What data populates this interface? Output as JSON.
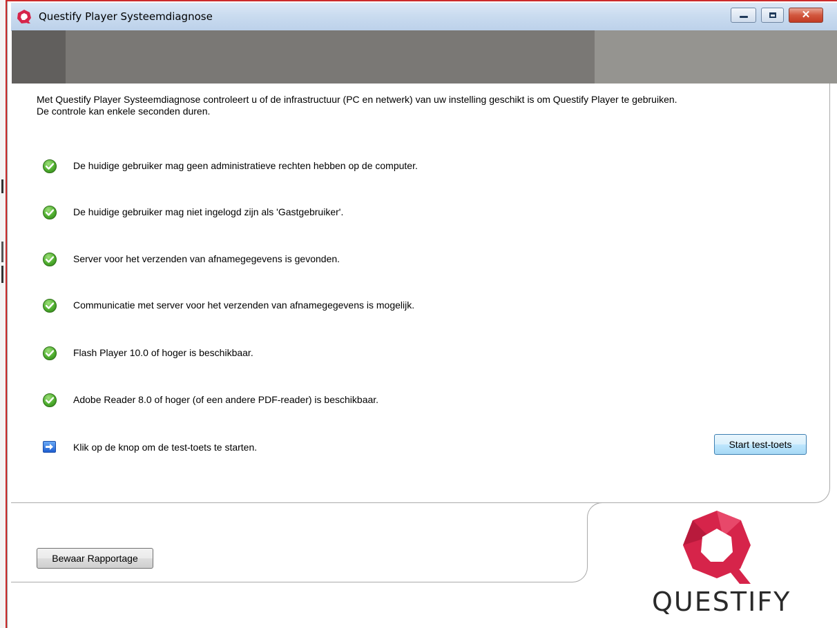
{
  "window": {
    "title": "Questify Player Systeemdiagnose",
    "controls": {
      "minimize": "minimize-icon",
      "maximize": "maximize-icon",
      "close": "close-icon"
    }
  },
  "intro": {
    "line1": "Met Questify Player Systeemdiagnose controleert u of de infrastructuur (PC en netwerk) van uw instelling geschikt is om Questify Player te gebruiken.",
    "line2": "De controle kan enkele seconden duren."
  },
  "checks": [
    {
      "status": "ok",
      "text": "De huidige gebruiker mag geen administratieve rechten hebben op de computer."
    },
    {
      "status": "ok",
      "text": "De huidige gebruiker mag niet ingelogd zijn als 'Gastgebruiker'."
    },
    {
      "status": "ok",
      "text": "Server voor het verzenden van afnamegegevens is gevonden."
    },
    {
      "status": "ok",
      "text": "Communicatie met server voor het verzenden van afnamegegevens is mogelijk."
    },
    {
      "status": "ok",
      "text": "Flash Player 10.0 of hoger is beschikbaar."
    },
    {
      "status": "ok",
      "text": "Adobe Reader 8.0 of hoger (of een andere PDF-reader) is beschikbaar."
    },
    {
      "status": "action",
      "text": "Klik op de knop om de test-toets te starten."
    }
  ],
  "buttons": {
    "start_test": "Start test-toets",
    "save_report": "Bewaar Rapportage"
  },
  "logo": {
    "text": "QUESTIFY",
    "color": "#d6244a"
  }
}
